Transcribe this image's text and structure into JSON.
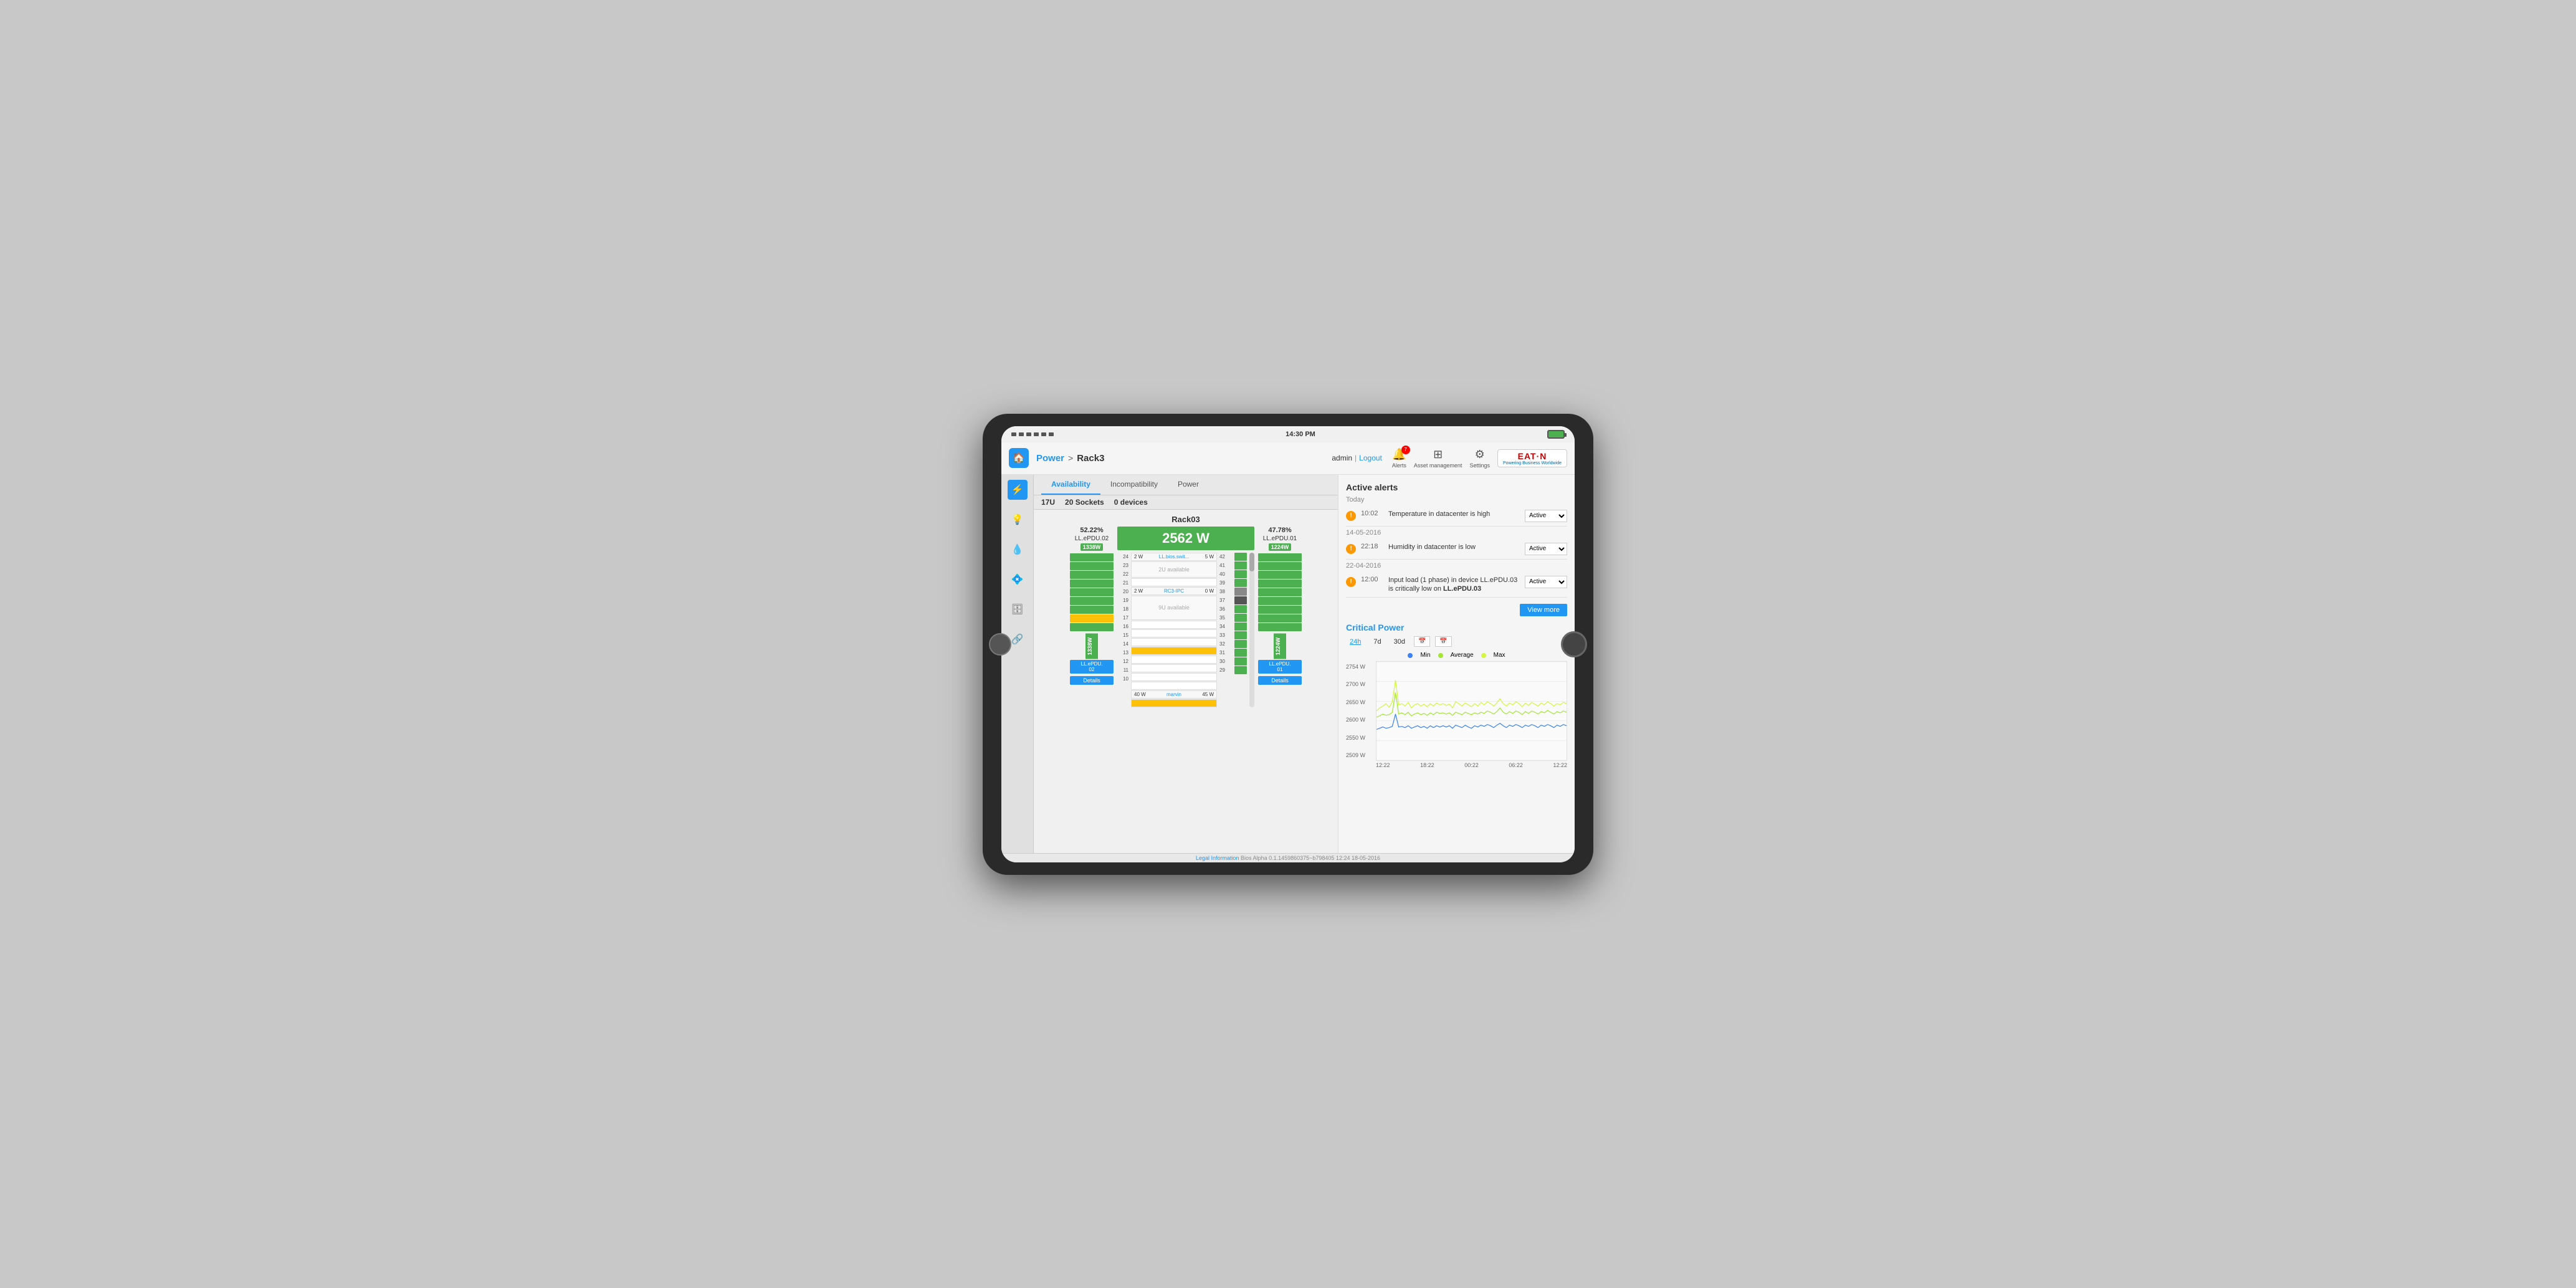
{
  "device": {
    "status_time": "14:30 PM",
    "battery_level": "full"
  },
  "nav": {
    "home_label": "🏠",
    "breadcrumb_power": "Power",
    "breadcrumb_sep": ">",
    "breadcrumb_rack": "Rack3",
    "admin_label": "admin",
    "sep_label": "|",
    "logout_label": "Logout",
    "alerts_label": "Alerts",
    "alerts_badge": "7",
    "asset_management_label": "Asset management",
    "settings_label": "Settings",
    "eaton_brand": "EAT·N",
    "eaton_sub": "Powering Business Worldwide"
  },
  "sidebar_icons": [
    "⚡",
    "💡",
    "💧",
    "⚙",
    "💾",
    "🔗"
  ],
  "tabs": {
    "items": [
      "Availability",
      "Incompatibility",
      "Power"
    ],
    "active": "Availability",
    "info": {
      "units": "17U",
      "sockets": "20 Sockets",
      "devices": "0 devices"
    }
  },
  "rack": {
    "title": "Rack03",
    "total_watts": "2562 W",
    "left_pdu": {
      "percent": "52.22%",
      "label": "LL.ePDU.02",
      "watts": "1338W",
      "device_label": "LL.ePDU.\n02",
      "details_btn": "Details"
    },
    "right_pdu": {
      "percent": "47.78%",
      "label": "LL.ePDU.01",
      "watts": "1224W",
      "device_label": "LL.ePDU.\n01",
      "details_btn": "Details"
    },
    "slots": [
      {
        "num": 24,
        "left_w": "2 W",
        "name": "LL.bios.swit...",
        "right_w": "5 W"
      },
      {
        "num": 23,
        "available": "2U available"
      },
      {
        "num": 22,
        "empty": true
      },
      {
        "num": 21,
        "left_w": "2 W",
        "name": "RC3-IPC",
        "right_w": "0 W"
      },
      {
        "num": 20,
        "available": "9U available"
      },
      {
        "num": 19,
        "empty": true
      },
      {
        "num": 18,
        "empty": true
      },
      {
        "num": 17,
        "empty": true
      },
      {
        "num": 16,
        "yellow": true
      },
      {
        "num": 15,
        "empty": true
      },
      {
        "num": 14,
        "empty": true
      },
      {
        "num": 13,
        "empty": true
      },
      {
        "num": 12,
        "empty": true
      },
      {
        "num": 11,
        "left_w": "40 W",
        "name": "marvin",
        "right_w": "45 W"
      },
      {
        "num": 10,
        "yellow": true
      }
    ],
    "right_nums": [
      42,
      41,
      40,
      39,
      38,
      37,
      36,
      35,
      34,
      33,
      32,
      31,
      30,
      29
    ]
  },
  "alerts": {
    "title": "Active alerts",
    "today_label": "Today",
    "items": [
      {
        "date_label": "Today",
        "time": "10:02",
        "msg": "Temperature in datacenter is high",
        "status": "Active"
      },
      {
        "date_label": "14-05-2016",
        "time": "22:18",
        "msg": "Humidity in datacenter is low",
        "status": "Active"
      },
      {
        "date_label": "22-04-2016",
        "time": "12:00",
        "msg": "Input load (1 phase) in device LL.ePDU.03 is critically low on LL.ePDU.03",
        "status": "Active"
      }
    ],
    "view_more_btn": "View more"
  },
  "critical_power": {
    "title": "Critical Power",
    "time_buttons": [
      "24h",
      "7d",
      "30d"
    ],
    "active_time": "24h",
    "legend": {
      "min_label": "Min",
      "min_color": "#3b82f6",
      "avg_label": "Average",
      "avg_color": "#a3e635",
      "max_label": "Max",
      "max_color": "#d4f542"
    },
    "y_labels": [
      "2754 W",
      "2700 W",
      "2650 W",
      "2600 W",
      "2550 W",
      "2509 W"
    ],
    "x_labels": [
      "12:22",
      "18:22",
      "00:22",
      "06:22",
      "12:22"
    ]
  },
  "footer": {
    "legal": "Legal Information",
    "bios_info": "Bios Alpha 0.1.1459860375~b798405 12:24 18-05-2016"
  }
}
